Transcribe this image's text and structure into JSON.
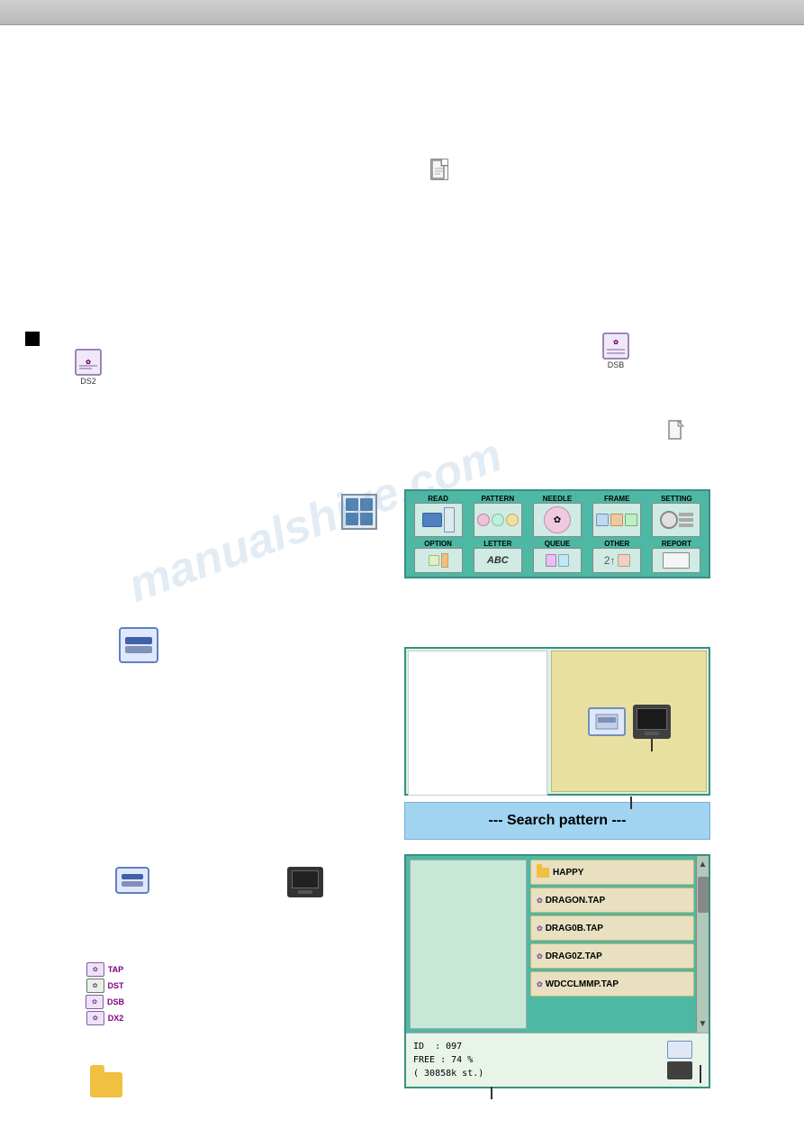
{
  "topbar": {
    "background": "#c0c0c0"
  },
  "watermark": {
    "text": "manualshive.com"
  },
  "icons": {
    "ds2_label": "DS2",
    "dsb_label": "DSB",
    "tap_label": "TAP",
    "dst_label": "DST",
    "dsb2_label": "DSB",
    "dx2_label": "DX2"
  },
  "panel": {
    "sections": [
      {
        "label": "READ",
        "id": "read"
      },
      {
        "label": "PATTERN",
        "id": "pattern"
      },
      {
        "label": "NEEDLE",
        "id": "needle"
      },
      {
        "label": "FRAME",
        "id": "frame"
      },
      {
        "label": "SETTING",
        "id": "setting"
      },
      {
        "label": "OPTION",
        "id": "option"
      },
      {
        "label": "LETTER",
        "id": "letter"
      },
      {
        "label": "QUEUE",
        "id": "queue"
      },
      {
        "label": "OTHER",
        "id": "other"
      },
      {
        "label": "REPORT",
        "id": "report"
      }
    ]
  },
  "search_pattern": {
    "label": "--- Search pattern ---"
  },
  "file_list": {
    "items": [
      {
        "name": "HAPPY",
        "type": "folder"
      },
      {
        "name": "DRAGON.TAP",
        "type": "tap"
      },
      {
        "name": "DRAG0B.TAP",
        "type": "tap"
      },
      {
        "name": "DRAG0Z.TAP",
        "type": "tap"
      },
      {
        "name": "WDCCLMMP.TAP",
        "type": "tap"
      }
    ]
  },
  "status": {
    "id_label": "ID",
    "id_value": "097",
    "free_label": "FREE",
    "free_value": "74 %",
    "size_value": "( 30858k st.)"
  }
}
